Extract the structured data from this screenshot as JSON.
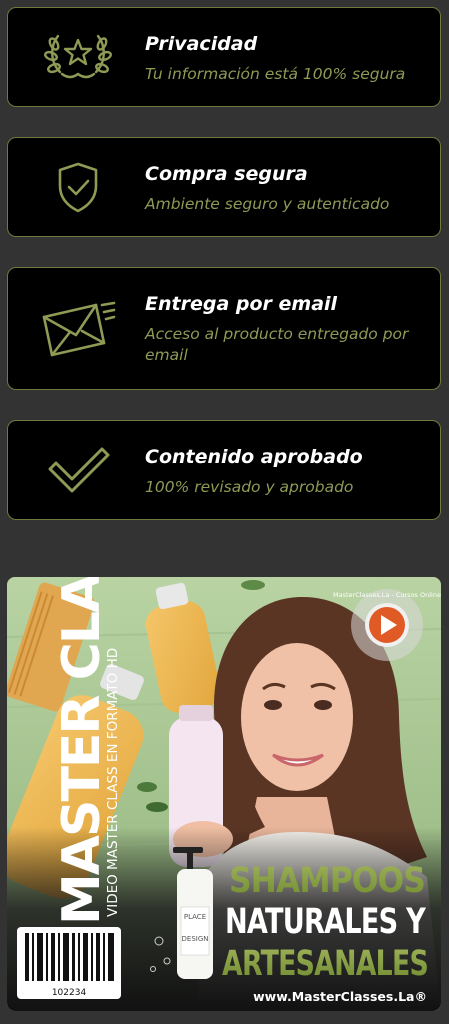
{
  "features": [
    {
      "title": "Privacidad",
      "description": "Tu información está 100% segura",
      "icon": "laurel-star-icon"
    },
    {
      "title": "Compra segura",
      "description": "Ambiente seguro y autenticado",
      "icon": "shield-check-icon"
    },
    {
      "title": "Entrega por email",
      "description": "Acceso al producto entregado por email",
      "icon": "envelope-fast-icon"
    },
    {
      "title": "Contenido aprobado",
      "description": "100% revisado y aprobado",
      "icon": "checkmark-icon"
    }
  ],
  "promo": {
    "side_title": "MASTER CLASS",
    "side_subtitle": "VIDEO MASTER CLASS EN FORMATO HD",
    "heading_line1": "SHAMPOOS",
    "heading_line2": "NATURALES Y",
    "heading_line3": "ARTESANALES",
    "website": "www.MasterClasses.La®",
    "barcode_number": "102234",
    "badge_text": "MasterClasses.La - Cursos Online",
    "bottle_label_top": "PLACE",
    "bottle_label_bottom": "DESIGN"
  },
  "colors": {
    "background": "#333333",
    "card_background": "#000000",
    "card_border": "#6f7a3c",
    "accent_olive": "#8f9a55",
    "heading_green": "#7a8f3d"
  }
}
